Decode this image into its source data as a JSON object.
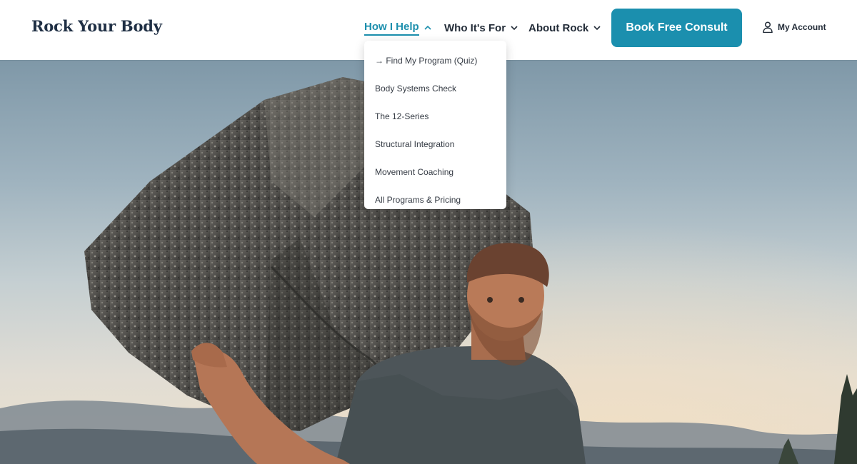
{
  "brand": {
    "logo": "Rock Your Body"
  },
  "nav": {
    "items": [
      {
        "label": "How I Help",
        "active": true
      },
      {
        "label": "Who It's For",
        "active": false
      },
      {
        "label": "About Rock",
        "active": false
      }
    ],
    "cta_label": "Book Free Consult",
    "account_label": "My Account"
  },
  "dropdown": {
    "items": [
      "→ Find My Program (Quiz)",
      "Body Systems Check",
      "The 12-Series",
      "Structural Integration",
      "Movement Coaching",
      "All Programs & Pricing"
    ]
  },
  "colors": {
    "accent": "#1b8fae",
    "logo": "#1f2f44",
    "nav_text": "#232c38"
  },
  "icons": {
    "nav_chevron": "chevron-down-icon",
    "active_chevron": "chevron-up-icon",
    "account": "user-icon"
  }
}
